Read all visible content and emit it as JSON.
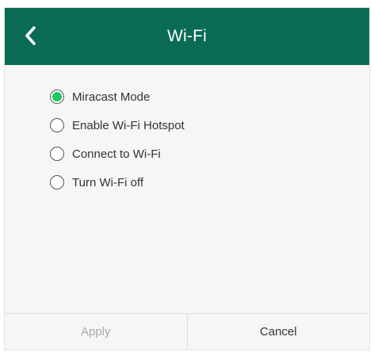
{
  "header": {
    "title": "Wi-Fi",
    "back_icon": "chevron-left-icon",
    "background_color": "#0a6b55"
  },
  "options": [
    {
      "label": "Miracast Mode",
      "selected": true
    },
    {
      "label": "Enable Wi-Fi Hotspot",
      "selected": false
    },
    {
      "label": "Connect to Wi-Fi",
      "selected": false
    },
    {
      "label": "Turn Wi-Fi off",
      "selected": false
    }
  ],
  "footer": {
    "apply_label": "Apply",
    "apply_enabled": false,
    "cancel_label": "Cancel"
  },
  "colors": {
    "selected_radio": "#1ec763"
  }
}
